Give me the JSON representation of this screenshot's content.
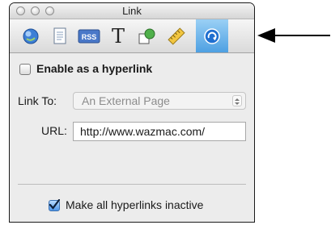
{
  "window": {
    "title": "Link"
  },
  "toolbar": {
    "tools": [
      {
        "icon": "document-inspector-icon",
        "active": false
      },
      {
        "icon": "page-inspector-icon",
        "active": false
      },
      {
        "icon": "rss-inspector-icon",
        "label": "RSS",
        "active": false
      },
      {
        "icon": "text-inspector-icon",
        "label": "T",
        "active": false
      },
      {
        "icon": "graphic-inspector-icon",
        "active": false
      },
      {
        "icon": "metrics-ruler-icon",
        "active": false
      },
      {
        "icon": "hyperlink-inspector-icon",
        "active": true
      }
    ]
  },
  "link": {
    "enable_label": "Enable as a hyperlink",
    "enable_checked": false,
    "link_to_label": "Link To:",
    "link_to_value": "An External Page",
    "url_label": "URL:",
    "url_value": "http://www.wazmac.com/",
    "make_inactive_label": "Make all hyperlinks inactive",
    "make_inactive_checked": true
  },
  "annotation": {
    "icon": "pointer-arrow-icon"
  },
  "colors": {
    "active_tab": "#4ea0e2",
    "panel_bg": "#ececec",
    "checkbox_checked": "#4f96e8"
  }
}
